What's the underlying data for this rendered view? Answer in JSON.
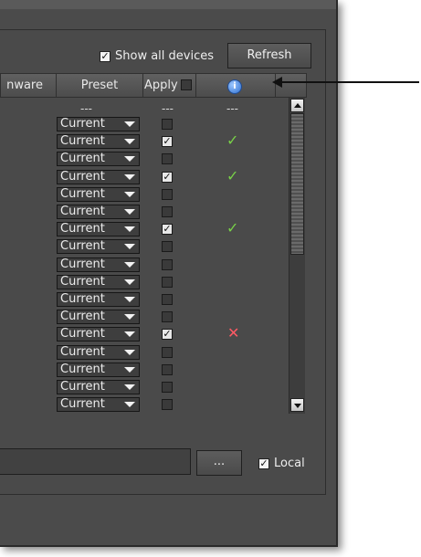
{
  "toolbar": {
    "show_all_devices_label": "Show all devices",
    "show_all_devices_checked": true,
    "refresh_label": "Refresh"
  },
  "table": {
    "headers": {
      "firmware": "nware",
      "preset": "Preset",
      "apply": "Apply",
      "info_icon": "info-icon"
    },
    "placeholder_row": {
      "preset": "---",
      "apply": "---",
      "status": "---"
    },
    "rows": [
      {
        "preset": "Current",
        "apply": false,
        "status": ""
      },
      {
        "preset": "Current",
        "apply": true,
        "status": "check"
      },
      {
        "preset": "Current",
        "apply": false,
        "status": ""
      },
      {
        "preset": "Current",
        "apply": true,
        "status": "check"
      },
      {
        "preset": "Current",
        "apply": false,
        "status": ""
      },
      {
        "preset": "Current",
        "apply": false,
        "status": ""
      },
      {
        "preset": "Current",
        "apply": true,
        "status": "check"
      },
      {
        "preset": "Current",
        "apply": false,
        "status": ""
      },
      {
        "preset": "Current",
        "apply": false,
        "status": ""
      },
      {
        "preset": "Current",
        "apply": false,
        "status": ""
      },
      {
        "preset": "Current",
        "apply": false,
        "status": ""
      },
      {
        "preset": "Current",
        "apply": false,
        "status": ""
      },
      {
        "preset": "Current",
        "apply": true,
        "status": "x"
      },
      {
        "preset": "Current",
        "apply": false,
        "status": ""
      },
      {
        "preset": "Current",
        "apply": false,
        "status": ""
      },
      {
        "preset": "Current",
        "apply": false,
        "status": ""
      },
      {
        "preset": "Current",
        "apply": false,
        "status": ""
      }
    ]
  },
  "bottom": {
    "path_value": "",
    "browse_label": "...",
    "local_label": "Local",
    "local_checked": true
  },
  "icons": {
    "check": "✓",
    "x": "✕",
    "checkbox_mark": "✓"
  },
  "colors": {
    "check": "#78d048",
    "x": "#ff5a64",
    "info": "#2f6fd0"
  }
}
